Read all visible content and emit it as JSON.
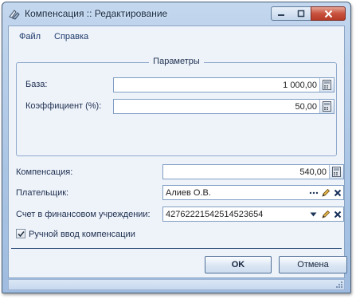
{
  "window": {
    "title": "Компенсация :: Редактирование"
  },
  "menu": {
    "file": "Файл",
    "help": "Справка"
  },
  "params": {
    "title": "Параметры",
    "base_label": "База:",
    "base_value": "1 000,00",
    "coef_label": "Коэффициент (%):",
    "coef_value": "50,00"
  },
  "form": {
    "compensation_label": "Компенсация:",
    "compensation_value": "540,00",
    "payer_label": "Плательщик:",
    "payer_value": "Алиев О.В.",
    "account_label": "Счет в финансовом учреждении:",
    "account_value": "42762221542514523654",
    "manual_label": "Ручной ввод компенсации",
    "manual_checked": true
  },
  "buttons": {
    "ok": "OK",
    "cancel": "Отмена"
  }
}
